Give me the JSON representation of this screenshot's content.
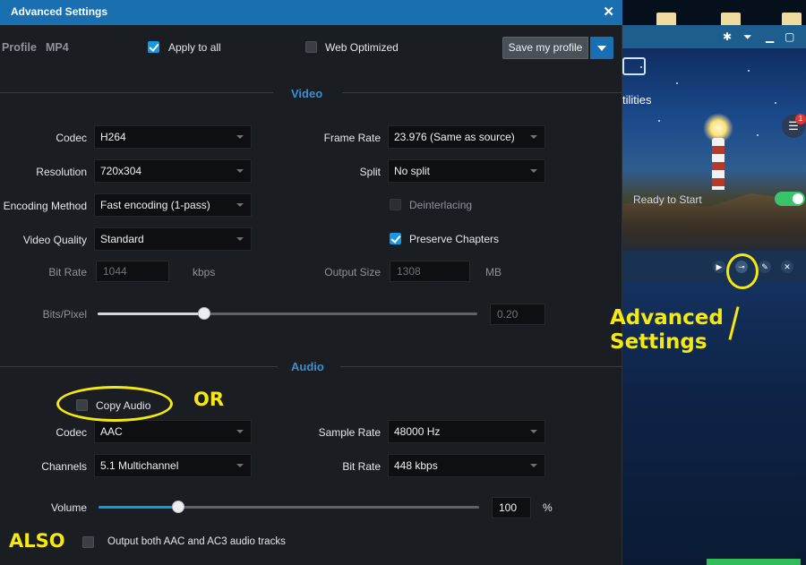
{
  "background_app": {
    "menu_label": "tilities",
    "status_text": "Ready to Start",
    "notification_count": "1"
  },
  "dialog": {
    "title": "Advanced Settings",
    "profile_label": "Profile",
    "profile_value": "MP4",
    "apply_all_label": "Apply to all",
    "apply_all_checked": true,
    "web_optimized_label": "Web Optimized",
    "web_optimized_checked": false,
    "save_profile_label": "Save my profile"
  },
  "video": {
    "section_title": "Video",
    "codec_label": "Codec",
    "codec_value": "H264",
    "resolution_label": "Resolution",
    "resolution_value": "720x304",
    "encoding_label": "Encoding Method",
    "encoding_value": "Fast encoding (1-pass)",
    "quality_label": "Video Quality",
    "quality_value": "Standard",
    "bitrate_label": "Bit Rate",
    "bitrate_value": "1044",
    "bitrate_unit": "kbps",
    "framerate_label": "Frame Rate",
    "framerate_value": "23.976 (Same as source)",
    "split_label": "Split",
    "split_value": "No split",
    "deinterlacing_label": "Deinterlacing",
    "deinterlacing_checked": false,
    "preserve_chapters_label": "Preserve Chapters",
    "preserve_chapters_checked": true,
    "output_size_label": "Output Size",
    "output_size_value": "1308",
    "output_size_unit": "MB",
    "bits_pixel_label": "Bits/Pixel",
    "bits_pixel_value": "0.20",
    "bits_pixel_slider_fraction": 0.28
  },
  "audio": {
    "section_title": "Audio",
    "copy_audio_label": "Copy Audio",
    "copy_audio_checked": false,
    "codec_label": "Codec",
    "codec_value": "AAC",
    "channels_label": "Channels",
    "channels_value": "5.1 Multichannel",
    "sample_rate_label": "Sample Rate",
    "sample_rate_value": "48000 Hz",
    "bitrate_label": "Bit Rate",
    "bitrate_value": "448 kbps",
    "volume_label": "Volume",
    "volume_value": "100",
    "volume_unit": "%",
    "volume_slider_fraction": 0.21,
    "dual_tracks_label": "Output both AAC and AC3 audio tracks",
    "dual_tracks_checked": false
  },
  "annotations": {
    "or_text": "OR",
    "also_text": "ALSO",
    "advanced_line1": "Advanced",
    "advanced_line2": "Settings",
    "color": "#f5e911"
  },
  "colors": {
    "title_bar": "#1a6fb0",
    "accent": "#1b97e0",
    "section_title": "#3d8fd0",
    "dialog_bg": "#1a1e23"
  }
}
